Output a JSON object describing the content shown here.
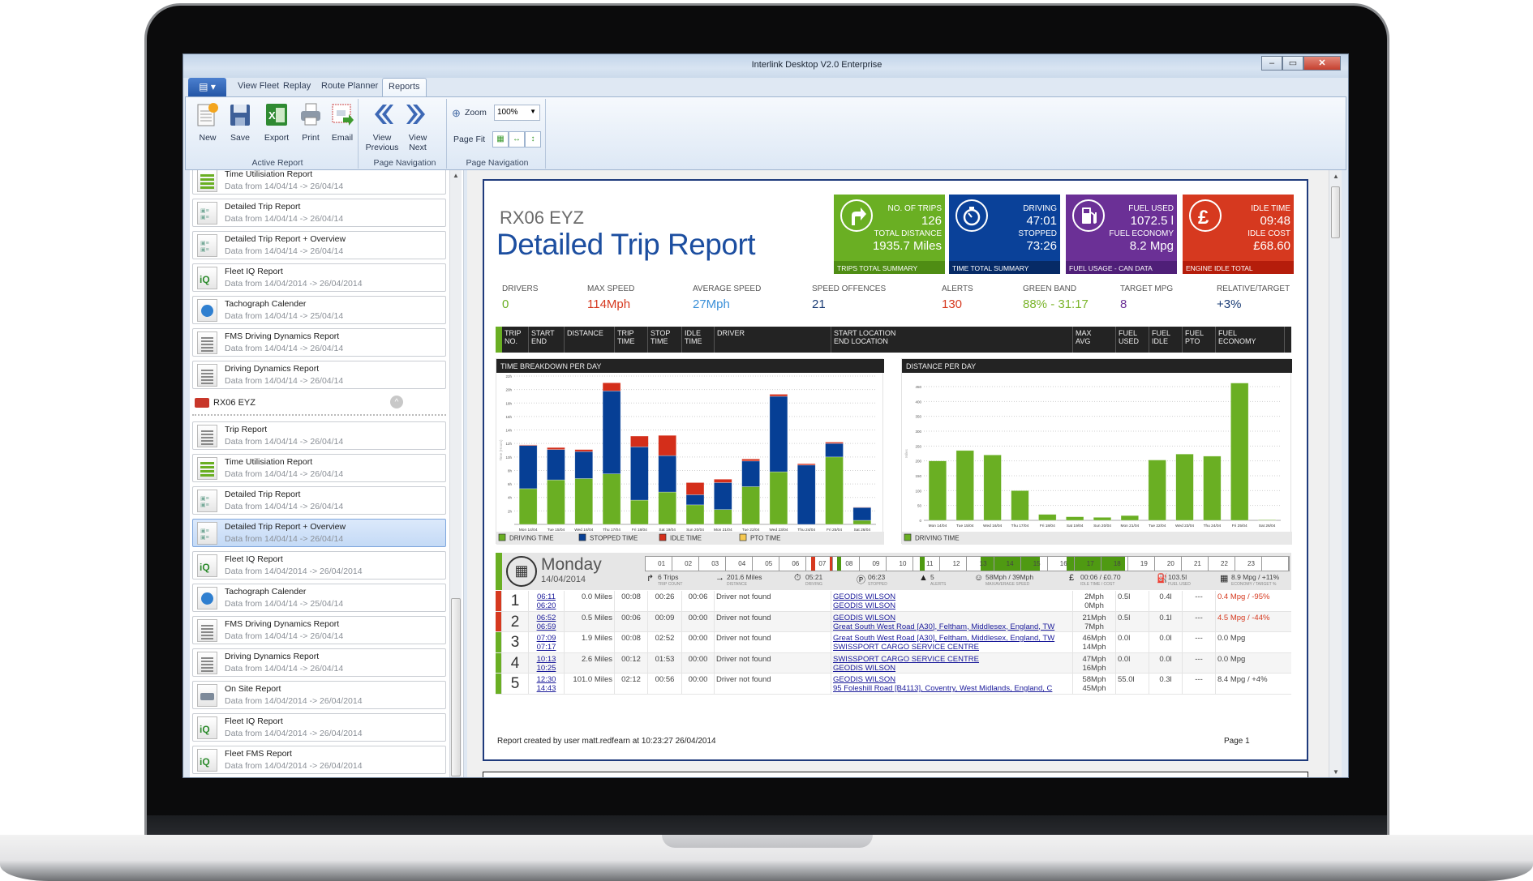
{
  "window": {
    "title": "Interlink Desktop V2.0 Enterprise",
    "controls": [
      "minimize",
      "maximize",
      "close"
    ]
  },
  "ribbon": {
    "tabs": [
      "View Fleet",
      "Replay",
      "Route Planner",
      "Reports"
    ],
    "active_tab": "Reports",
    "buttons": {
      "new": "New",
      "save": "Save",
      "export": "Export",
      "print": "Print",
      "email": "Email",
      "view_previous_1": "View",
      "view_previous_2": "Previous",
      "view_next_1": "View",
      "view_next_2": "Next"
    },
    "groups": {
      "active_report": "Active Report",
      "page_navigation": "Page Navigation",
      "page_navigation_2": "Page Navigation"
    },
    "zoom_label": "Zoom",
    "zoom_value": "100%",
    "page_fit_label": "Page Fit"
  },
  "sidebar": {
    "items_top": [
      {
        "title": "Time Utilisiation Report",
        "range": "Data from 14/04/14  ->  26/04/14",
        "icon": "bars"
      },
      {
        "title": "Detailed Trip Report",
        "range": "Data from 14/04/14  ->  26/04/14",
        "icon": "trip"
      },
      {
        "title": "Detailed Trip Report + Overview",
        "range": "Data from 14/04/14  ->  26/04/14",
        "icon": "trip"
      },
      {
        "title": "Fleet IQ Report",
        "range": "Data from 14/04/2014  ->  26/04/2014",
        "icon": "iq"
      },
      {
        "title": "Tachograph Calender",
        "range": "Data from 14/04/14  ->  25/04/14",
        "icon": "clock"
      },
      {
        "title": "FMS Driving Dynamics Report",
        "range": "Data from 14/04/14  ->  26/04/14",
        "icon": "doc"
      },
      {
        "title": "Driving Dynamics Report",
        "range": "Data from 14/04/14  ->  26/04/14",
        "icon": "doc"
      }
    ],
    "group": {
      "title": "RX06 EYZ",
      "icon": "truck-icon"
    },
    "items_group": [
      {
        "title": "Trip Report",
        "range": "Data from 14/04/14  ->  26/04/14",
        "icon": "doc"
      },
      {
        "title": "Time Utilisiation Report",
        "range": "Data from 14/04/14  ->  26/04/14",
        "icon": "bars"
      },
      {
        "title": "Detailed Trip Report",
        "range": "Data from 14/04/14  ->  26/04/14",
        "icon": "trip"
      },
      {
        "title": "Detailed Trip Report + Overview",
        "range": "Data from 14/04/14  ->  26/04/14",
        "icon": "trip",
        "selected": true
      },
      {
        "title": "Fleet IQ Report",
        "range": "Data from 14/04/2014  ->  26/04/2014",
        "icon": "iq"
      },
      {
        "title": "Tachograph Calender",
        "range": "Data from 14/04/14  ->  25/04/14",
        "icon": "clock"
      },
      {
        "title": "FMS Driving Dynamics Report",
        "range": "Data from 14/04/14  ->  26/04/14",
        "icon": "doc"
      },
      {
        "title": "Driving Dynamics Report",
        "range": "Data from 14/04/14  ->  26/04/14",
        "icon": "doc"
      },
      {
        "title": "On Site Report",
        "range": "Data from 14/04/2014  ->  26/04/2014",
        "icon": "onsite"
      },
      {
        "title": "Fleet IQ Report",
        "range": "Data from 14/04/2014  ->  26/04/2014",
        "icon": "iq"
      },
      {
        "title": "Fleet FMS Report",
        "range": "Data from 14/04/2014  ->  26/04/2014",
        "icon": "iq"
      }
    ]
  },
  "report": {
    "registration": "RX06 EYZ",
    "title": "Detailed Trip Report",
    "tiles": [
      {
        "label1": "NO. OF TRIPS",
        "value1": "126",
        "label2": "TOTAL DISTANCE",
        "value2": "1935.7 Miles",
        "footer": "TRIPS TOTAL SUMMARY",
        "icon": "turn-right-arrow-icon",
        "color": "#6aaf23",
        "footer_color": "#4f8d14"
      },
      {
        "label1": "DRIVING",
        "value1": "47:01",
        "label2": "STOPPED",
        "value2": "73:26",
        "footer": "TIME TOTAL SUMMARY",
        "icon": "stopwatch-icon",
        "color": "#0a4199",
        "footer_color": "#062a66"
      },
      {
        "label1": "FUEL USED",
        "value1": "1072.5 l",
        "label2": "FUEL ECONOMY",
        "value2": "8.2 Mpg",
        "footer": "FUEL USAGE - CAN DATA",
        "icon": "fuel-pump-icon",
        "color": "#6b3096",
        "footer_color": "#4f1f78"
      },
      {
        "label1": "IDLE TIME",
        "value1": "09:48",
        "label2": "IDLE COST",
        "value2": "£68.60",
        "footer": "ENGINE IDLE TOTAL",
        "icon": "pound-icon",
        "color": "#d6391f",
        "footer_color": "#b51d0b"
      }
    ],
    "stats": [
      {
        "label": "DRIVERS",
        "value": "0",
        "color": "#6aaf23"
      },
      {
        "label": "MAX SPEED",
        "value": "114Mph",
        "color": "#d6391f"
      },
      {
        "label": "AVERAGE SPEED",
        "value": "27Mph",
        "color": "#3a8fd8"
      },
      {
        "label": "SPEED OFFENCES",
        "value": "21",
        "color": "#1a3c75"
      },
      {
        "label": "ALERTS",
        "value": "130",
        "color": "#d6391f"
      },
      {
        "label": "GREEN BAND",
        "value": "88% - 31:17",
        "color": "#7bb52b"
      },
      {
        "label": "TARGET MPG",
        "value": "8",
        "color": "#6b3096"
      },
      {
        "label": "RELATIVE/TARGET",
        "value": "+3%",
        "color": "#1a3c75"
      }
    ],
    "table_headers": [
      [
        "TRIP",
        "NO."
      ],
      [
        "START",
        "END"
      ],
      [
        "DISTANCE",
        ""
      ],
      [
        "TRIP",
        "TIME"
      ],
      [
        "STOP",
        "TIME"
      ],
      [
        "IDLE",
        "TIME"
      ],
      [
        "DRIVER",
        ""
      ],
      [
        "START LOCATION",
        "END LOCATION"
      ],
      [
        "MAX",
        "AVG"
      ],
      [
        "FUEL",
        "USED"
      ],
      [
        "FUEL",
        "IDLE"
      ],
      [
        "FUEL",
        "PTO"
      ],
      [
        "FUEL",
        "ECONOMY"
      ]
    ],
    "day": {
      "name": "Monday",
      "date": "14/04/2014",
      "hour_labels": [
        "01",
        "02",
        "03",
        "04",
        "05",
        "06",
        "07",
        "08",
        "09",
        "10",
        "11",
        "12",
        "13",
        "14",
        "15",
        "16",
        "17",
        "18",
        "19",
        "20",
        "21",
        "22",
        "23",
        ""
      ],
      "activity_hours": [
        {
          "start": 6.18,
          "end": 6.33,
          "color": "#d6391f"
        },
        {
          "start": 6.87,
          "end": 6.98,
          "color": "#d6391f"
        },
        {
          "start": 7.15,
          "end": 7.28,
          "color": "#4f9a12"
        },
        {
          "start": 10.22,
          "end": 10.42,
          "color": "#4f9a12"
        },
        {
          "start": 12.5,
          "end": 14.72,
          "color": "#4f9a12"
        },
        {
          "start": 15.7,
          "end": 17.9,
          "color": "#4f9a12"
        }
      ],
      "summary": [
        {
          "icon": "turn-arrow-icon",
          "value": "6 Trips",
          "label": "TRIP COUNT"
        },
        {
          "icon": "arrow-right-icon",
          "value": "201.6 Miles",
          "label": "DISTANCE"
        },
        {
          "icon": "stopwatch-icon",
          "value": "05:21",
          "label": "DRIVING"
        },
        {
          "icon": "parking-icon",
          "value": "06:23",
          "label": "STOPPED"
        },
        {
          "icon": "warning-icon",
          "value": "5",
          "label": "ALERTS"
        },
        {
          "icon": "speedometer-icon",
          "value": "58Mph / 39Mph",
          "label": "MAX/AVERAGE SPEED"
        },
        {
          "icon": "pound-icon",
          "value": "00:06 / £0.70",
          "label": "IDLE TIME / COST"
        },
        {
          "icon": "fuel-pump-icon",
          "value": "103.5l",
          "label": "FUEL USED"
        },
        {
          "icon": "calculator-icon",
          "value": "8.9 Mpg / +11%",
          "label": "ECONOMY / TARGET %"
        }
      ]
    },
    "rows": [
      {
        "no": "1",
        "start": "06:11",
        "end": "06:20",
        "distance": "0.0 Miles",
        "trip": "00:08",
        "stop": "00:26",
        "idle": "00:06",
        "driver": "Driver not found",
        "start_loc": "GEODIS WILSON",
        "end_loc": "GEODIS WILSON",
        "max": "2Mph",
        "avg": "0Mph",
        "fuel_used": "0.5l",
        "fuel_idle": "0.4l",
        "pto": "---",
        "economy": "0.4 Mpg / -95%",
        "status": "#d6391f",
        "economy_color": "#d6391f"
      },
      {
        "no": "2",
        "start": "06:52",
        "end": "06:59",
        "distance": "0.5 Miles",
        "trip": "00:06",
        "stop": "00:09",
        "idle": "00:00",
        "driver": "Driver not found",
        "start_loc": "GEODIS WILSON",
        "end_loc": "Great South West Road [A30], Feltham, Middlesex, England, TW",
        "max": "21Mph",
        "avg": "7Mph",
        "fuel_used": "0.5l",
        "fuel_idle": "0.1l",
        "pto": "---",
        "economy": "4.5 Mpg / -44%",
        "status": "#d6391f",
        "economy_color": "#d6391f"
      },
      {
        "no": "3",
        "start": "07:09",
        "end": "07:17",
        "distance": "1.9 Miles",
        "trip": "00:08",
        "stop": "02:52",
        "idle": "00:00",
        "driver": "Driver not found",
        "start_loc": "Great South West Road [A30], Feltham, Middlesex, England, TW",
        "end_loc": "SWISSPORT CARGO SERVICE CENTRE",
        "max": "46Mph",
        "avg": "14Mph",
        "fuel_used": "0.0l",
        "fuel_idle": "0.0l",
        "pto": "---",
        "economy": "0.0 Mpg",
        "status": "#6aaf23",
        "economy_color": "#444444"
      },
      {
        "no": "4",
        "start": "10:13",
        "end": "10:25",
        "distance": "2.6 Miles",
        "trip": "00:12",
        "stop": "01:53",
        "idle": "00:00",
        "driver": "Driver not found",
        "start_loc": "SWISSPORT CARGO SERVICE CENTRE",
        "end_loc": "GEODIS WILSON",
        "max": "47Mph",
        "avg": "16Mph",
        "fuel_used": "0.0l",
        "fuel_idle": "0.0l",
        "pto": "---",
        "economy": "0.0 Mpg",
        "status": "#6aaf23",
        "economy_color": "#444444"
      },
      {
        "no": "5",
        "start": "12:30",
        "end": "14:43",
        "distance": "101.0 Miles",
        "trip": "02:12",
        "stop": "00:56",
        "idle": "00:00",
        "driver": "Driver not found",
        "start_loc": "GEODIS WILSON",
        "end_loc": "95 Foleshill Road [B4113], Coventry, West Midlands, England, C",
        "max": "58Mph",
        "avg": "45Mph",
        "fuel_used": "55.0l",
        "fuel_idle": "0.3l",
        "pto": "---",
        "economy": "8.4 Mpg / +4%",
        "status": "#6aaf23",
        "economy_color": "#444444"
      }
    ],
    "footer": {
      "created": "Report created by user matt.redfearn at 10:23:27  26/04/2014",
      "page": "Page 1"
    }
  },
  "chart_data": [
    {
      "type": "bar",
      "stacked": true,
      "title": "TIME BREAKDOWN PER DAY",
      "ylabel": "Time (Hours)",
      "xlabel": "",
      "ylim": [
        0,
        22
      ],
      "yticks": [
        "",
        "2h",
        "4h",
        "6h",
        "8h",
        "10h",
        "12h",
        "14h",
        "16h",
        "18h",
        "20h",
        "22h"
      ],
      "grid": true,
      "legend": "bottom",
      "categories": [
        "Mon 14/04",
        "Tue 15/04",
        "Wed 16/04",
        "Thu 17/04",
        "Fri 18/04",
        "Sat 19/04",
        "Sun 20/04",
        "Mon 21/04",
        "Tue 22/04",
        "Wed 23/04",
        "Thu 24/04",
        "Fri 25/04",
        "Sat 26/04"
      ],
      "series": [
        {
          "name": "DRIVING TIME",
          "color": "#6aaf23",
          "values": [
            5.3,
            6.6,
            6.8,
            7.5,
            3.6,
            4.8,
            2.9,
            2.2,
            5.6,
            7.8,
            0,
            10.0,
            0.6
          ]
        },
        {
          "name": "STOPPED TIME",
          "color": "#063f95",
          "values": [
            6.4,
            4.5,
            4.0,
            12.3,
            7.9,
            5.4,
            1.5,
            4.0,
            3.8,
            11.2,
            8.8,
            2.0,
            1.9
          ]
        },
        {
          "name": "IDLE TIME",
          "color": "#d42e1a",
          "values": [
            0.1,
            0.3,
            0.3,
            1.2,
            1.6,
            3.0,
            1.8,
            0.5,
            0.3,
            0.3,
            0.2,
            0.2,
            0.05
          ]
        },
        {
          "name": "PTO TIME",
          "color": "#f5c850",
          "values": [
            0,
            0,
            0,
            0,
            0,
            0,
            0,
            0,
            0,
            0,
            0,
            0,
            0
          ]
        }
      ]
    },
    {
      "type": "bar",
      "title": "DISTANCE PER DAY",
      "ylabel": "Miles",
      "xlabel": "",
      "ylim": [
        0,
        450
      ],
      "yticks": [
        "0",
        "50",
        "100",
        "150",
        "200",
        "250",
        "300",
        "350",
        "400",
        "450"
      ],
      "grid": true,
      "legend": "bottom",
      "categories": [
        "Mon 14/04",
        "Tue 15/04",
        "Wed 16/04",
        "Thu 17/04",
        "Fri 18/04",
        "Sat 19/04",
        "Sun 20/04",
        "Mon 21/04",
        "Tue 22/04",
        "Wed 23/04",
        "Thu 24/04",
        "Fri 25/04",
        "Sat 26/04"
      ],
      "series": [
        {
          "name": "DRIVING TIME",
          "color": "#6aaf23",
          "values": [
            200,
            235,
            220,
            100,
            20,
            12,
            10,
            16,
            203,
            223,
            216,
            462,
            2
          ]
        }
      ]
    }
  ]
}
